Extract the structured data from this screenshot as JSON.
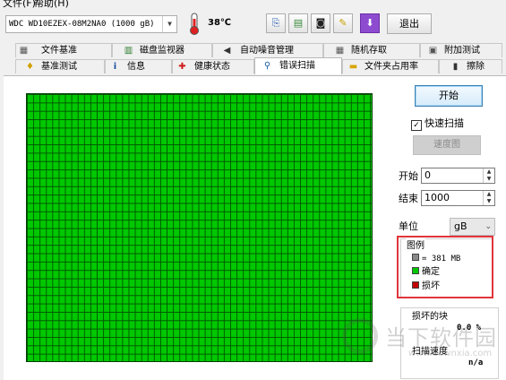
{
  "menu": {
    "file": "文件(F)",
    "help": "帮助(H)"
  },
  "toolbar": {
    "drive_select_value": "WDC WD10EZEX-08M2NA0 (1000 gB)",
    "temperature": "38℃",
    "exit_label": "退出",
    "buttons": [
      {
        "icon": "copy-icon",
        "glyph": "⎘"
      },
      {
        "icon": "save-icon",
        "glyph": "▤"
      },
      {
        "icon": "camera-icon",
        "glyph": "◙"
      },
      {
        "icon": "tools-icon",
        "glyph": "✎"
      },
      {
        "icon": "download-icon",
        "glyph": "⬇"
      }
    ]
  },
  "tabs_row1": [
    {
      "label": "文件基准",
      "icon": "file-benchmark-icon",
      "glyph": "▦"
    },
    {
      "label": "磁盘监视器",
      "icon": "disk-monitor-icon",
      "glyph": "▥"
    },
    {
      "label": "自动噪音管理",
      "icon": "speaker-icon",
      "glyph": "◀"
    },
    {
      "label": "随机存取",
      "icon": "random-access-icon",
      "glyph": "▦"
    },
    {
      "label": "附加测试",
      "icon": "extra-tests-icon",
      "glyph": "▣"
    }
  ],
  "tabs_row2": [
    {
      "label": "基准测试",
      "icon": "benchmark-icon",
      "glyph": "♦"
    },
    {
      "label": "信息",
      "icon": "info-icon",
      "glyph": "i"
    },
    {
      "label": "健康状态",
      "icon": "health-cross-icon",
      "glyph": "✚"
    },
    {
      "label": "错误扫描",
      "icon": "magnifier-icon",
      "glyph": "⚲",
      "active": true
    },
    {
      "label": "文件夹占用率",
      "icon": "folder-icon",
      "glyph": "▬"
    },
    {
      "label": "擦除",
      "icon": "trash-icon",
      "glyph": "▮"
    }
  ],
  "scan": {
    "start_label": "开始",
    "quick_scan_label": "快速扫描",
    "quick_scan_checked": true,
    "slow_label": "速度图",
    "start_field_label": "开始",
    "start_value": "0",
    "end_field_label": "结束",
    "end_value": "1000",
    "unit_label": "单位",
    "unit_value": "gB"
  },
  "legend": {
    "title": "图例",
    "block_size": "= 381 MB",
    "ok_label": "确定",
    "damaged_label": "损坏",
    "colors": {
      "block": "#8a8a8a",
      "ok": "#00c800",
      "damaged": "#c00000"
    }
  },
  "stats": {
    "damaged_blocks_label": "损坏的块",
    "damaged_blocks_value": "0.0 %",
    "scan_speed_label": "扫描速度",
    "scan_speed_value": "n/a"
  },
  "watermark": {
    "main": "当下软件园",
    "url": "www.downxia.com"
  },
  "colors": {
    "scan_ok": "#00c800",
    "highlight": "#e0353a"
  }
}
